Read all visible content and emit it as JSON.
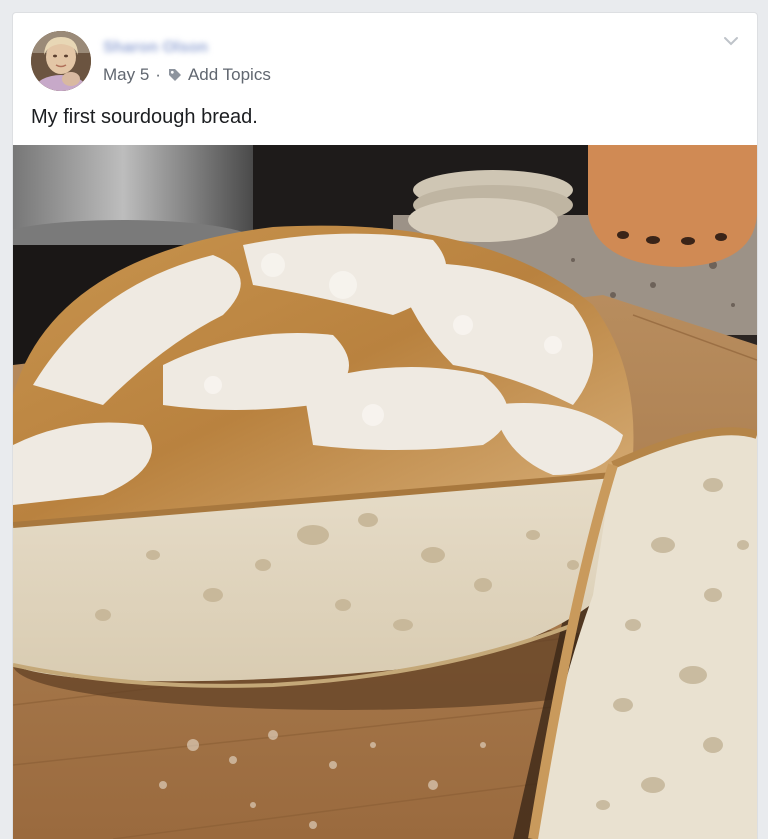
{
  "post": {
    "author_name": "Sharon Olson",
    "date": "May 5",
    "separator": "·",
    "add_topics_label": "Add Topics",
    "text": "My first sourdough bread."
  },
  "icons": {
    "tag": "tag-icon",
    "menu": "chevron-down-icon",
    "avatar": "avatar"
  },
  "colors": {
    "page_bg": "#e9ebee",
    "card_bg": "#ffffff",
    "meta_text": "#616770",
    "body_text": "#1c1e21",
    "author_link": "#98a9d6"
  }
}
